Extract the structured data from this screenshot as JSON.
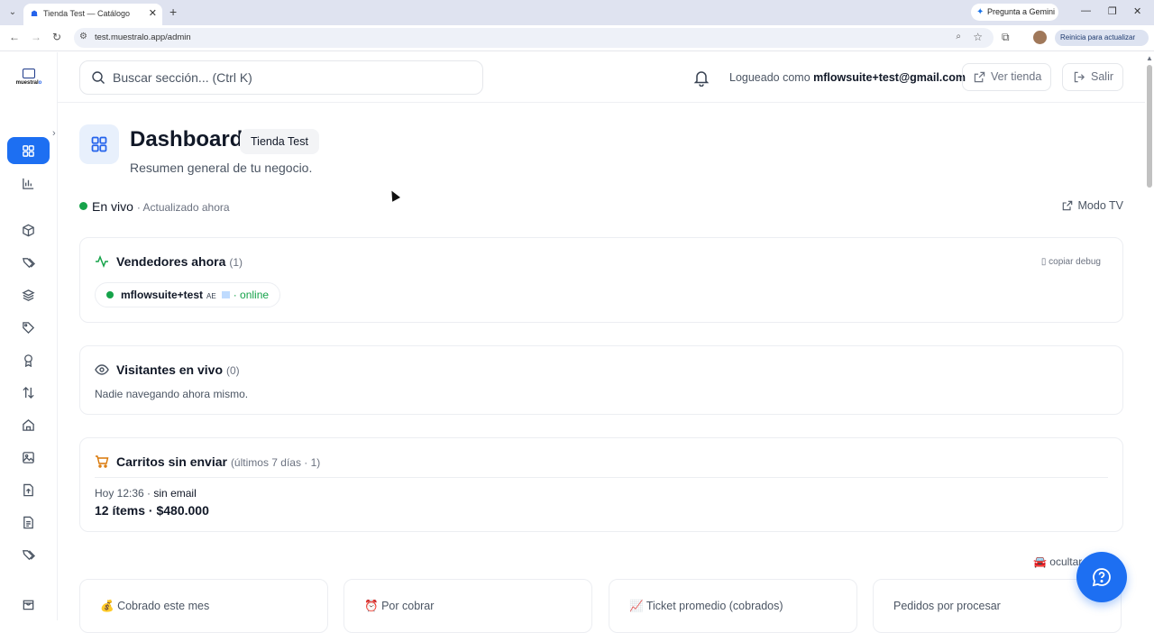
{
  "browser": {
    "tab_title": "Tienda Test — Catálogo",
    "gemini_label": "Pregunta a Gemini",
    "url": "test.muestralo.app/admin",
    "update_label": "Reinicia para actualizar"
  },
  "sidebar": {
    "logo_text_a": "muestral",
    "logo_text_b": "o",
    "items": [
      "dashboard",
      "analytics",
      "products",
      "tags",
      "layers",
      "discounts",
      "awards",
      "transfers",
      "home",
      "images",
      "uploads",
      "documents",
      "coupons",
      "orders"
    ]
  },
  "topbar": {
    "search_placeholder": "Buscar sección... (Ctrl K)",
    "logged_prefix": "Logueado como",
    "user_email": "mflowsuite+test@gmail.com",
    "view_store": "Ver tienda",
    "logout": "Salir"
  },
  "header": {
    "title": "Dashboard",
    "store_badge": "Tienda Test",
    "subtitle": "Resumen general de tu negocio."
  },
  "live": {
    "label": "En vivo",
    "updated": "· Actualizado ahora",
    "tv_mode": "Modo TV"
  },
  "sellers": {
    "title": "Vendedores ahora",
    "count": "(1)",
    "debug": "copiar debug",
    "items": [
      {
        "name": "mflowsuite+test",
        "code": "AE",
        "status": "· online"
      }
    ]
  },
  "visitors": {
    "title": "Visitantes en vivo",
    "count": "(0)",
    "empty": "Nadie navegando ahora mismo."
  },
  "carts": {
    "title": "Carritos sin enviar",
    "count": "(últimos 7 días · 1)",
    "items": [
      {
        "when": "Hoy 12:36 ·",
        "email": "sin email",
        "summary": "12 ítems · $480.000"
      }
    ]
  },
  "hide_label": "ocultar",
  "stats": [
    {
      "label": "Cobrado este mes",
      "emoji": "💰"
    },
    {
      "label": "Por cobrar",
      "emoji": "⏰"
    },
    {
      "label": "Ticket promedio (cobrados)",
      "emoji": "📈"
    },
    {
      "label": "Pedidos por procesar",
      "emoji": ""
    }
  ],
  "colors": {
    "accent": "#1d6ff2",
    "live": "#16a34a",
    "cart_icon": "#d97706"
  }
}
